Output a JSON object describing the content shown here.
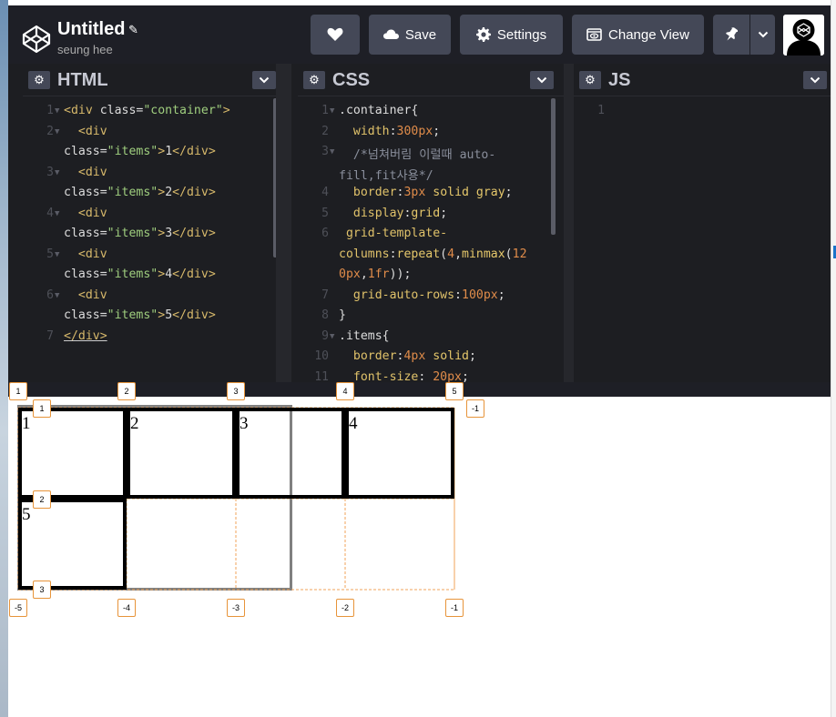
{
  "header": {
    "title": "Untitled",
    "author": "seung hee"
  },
  "toolbar": {
    "save_label": "Save",
    "settings_label": "Settings",
    "change_view_label": "Change View"
  },
  "panes": [
    {
      "title": "HTML"
    },
    {
      "title": "CSS"
    },
    {
      "title": "JS"
    }
  ],
  "html_code": {
    "line_numbers": [
      "1",
      "2",
      "3",
      "4",
      "5",
      "6",
      "7"
    ],
    "lines": [
      [
        {
          "t": "<div ",
          "c": "tg"
        },
        {
          "t": "class",
          "c": "at"
        },
        {
          "t": "=",
          "c": "at"
        },
        {
          "t": "\"container\"",
          "c": "st"
        },
        {
          "t": ">",
          "c": "tg"
        }
      ],
      [
        {
          "t": "  <div",
          "c": "tg"
        }
      ],
      [
        {
          "t": "class",
          "c": "at"
        },
        {
          "t": "=",
          "c": "at"
        },
        {
          "t": "\"items\"",
          "c": "st"
        },
        {
          "t": ">",
          "c": "tg"
        },
        {
          "t": "1",
          "c": "at"
        },
        {
          "t": "</div>",
          "c": "tg"
        }
      ],
      [
        {
          "t": "  <div",
          "c": "tg"
        }
      ],
      [
        {
          "t": "class",
          "c": "at"
        },
        {
          "t": "=",
          "c": "at"
        },
        {
          "t": "\"items\"",
          "c": "st"
        },
        {
          "t": ">",
          "c": "tg"
        },
        {
          "t": "2",
          "c": "at"
        },
        {
          "t": "</div>",
          "c": "tg"
        }
      ],
      [
        {
          "t": "  <div",
          "c": "tg"
        }
      ],
      [
        {
          "t": "class",
          "c": "at"
        },
        {
          "t": "=",
          "c": "at"
        },
        {
          "t": "\"items\"",
          "c": "st"
        },
        {
          "t": ">",
          "c": "tg"
        },
        {
          "t": "3",
          "c": "at"
        },
        {
          "t": "</div>",
          "c": "tg"
        }
      ],
      [
        {
          "t": "  <div",
          "c": "tg"
        }
      ],
      [
        {
          "t": "class",
          "c": "at"
        },
        {
          "t": "=",
          "c": "at"
        },
        {
          "t": "\"items\"",
          "c": "st"
        },
        {
          "t": ">",
          "c": "tg"
        },
        {
          "t": "4",
          "c": "at"
        },
        {
          "t": "</div>",
          "c": "tg"
        }
      ],
      [
        {
          "t": "  <div",
          "c": "tg"
        }
      ],
      [
        {
          "t": "class",
          "c": "at"
        },
        {
          "t": "=",
          "c": "at"
        },
        {
          "t": "\"items\"",
          "c": "st"
        },
        {
          "t": ">",
          "c": "tg"
        },
        {
          "t": "5",
          "c": "at"
        },
        {
          "t": "</div>",
          "c": "tg"
        }
      ],
      [
        {
          "t": "</div>",
          "c": "tg"
        }
      ]
    ]
  },
  "css_code": {
    "line_numbers": [
      "1",
      "2",
      "3",
      "4",
      "5",
      "6",
      "7",
      "8",
      "9",
      "10",
      "11"
    ],
    "lines": [
      [
        {
          "t": ".container",
          "c": "sel"
        },
        {
          "t": "{",
          "c": "at"
        }
      ],
      [
        {
          "t": "  width",
          "c": "pr"
        },
        {
          "t": ":",
          "c": "at"
        },
        {
          "t": "300px",
          "c": "nu"
        },
        {
          "t": ";",
          "c": "at"
        }
      ],
      [
        {
          "t": "  /*넘쳐버림 이럴때 auto-",
          "c": "cm"
        }
      ],
      [
        {
          "t": "fill,fit사용*/",
          "c": "cm"
        }
      ],
      [
        {
          "t": "  border",
          "c": "pr"
        },
        {
          "t": ":",
          "c": "at"
        },
        {
          "t": "3px",
          "c": "nu"
        },
        {
          "t": " solid gray",
          "c": "kw"
        },
        {
          "t": ";",
          "c": "at"
        }
      ],
      [
        {
          "t": "  display",
          "c": "pr"
        },
        {
          "t": ":",
          "c": "at"
        },
        {
          "t": "grid",
          "c": "kw"
        },
        {
          "t": ";",
          "c": "at"
        }
      ],
      [
        {
          "t": " grid-template-",
          "c": "pr"
        }
      ],
      [
        {
          "t": "columns",
          "c": "pr"
        },
        {
          "t": ":",
          "c": "at"
        },
        {
          "t": "repeat",
          "c": "kw"
        },
        {
          "t": "(",
          "c": "at"
        },
        {
          "t": "4",
          "c": "nu"
        },
        {
          "t": ",",
          "c": "at"
        },
        {
          "t": "minmax",
          "c": "kw"
        },
        {
          "t": "(",
          "c": "at"
        },
        {
          "t": "12",
          "c": "nu"
        }
      ],
      [
        {
          "t": "0px",
          "c": "nu"
        },
        {
          "t": ",",
          "c": "at"
        },
        {
          "t": "1fr",
          "c": "nu"
        },
        {
          "t": "));",
          "c": "at"
        }
      ],
      [
        {
          "t": "  grid-auto-rows",
          "c": "pr"
        },
        {
          "t": ":",
          "c": "at"
        },
        {
          "t": "100px",
          "c": "nu"
        },
        {
          "t": ";",
          "c": "at"
        }
      ],
      [
        {
          "t": "}",
          "c": "at"
        }
      ],
      [
        {
          "t": ".items",
          "c": "sel"
        },
        {
          "t": "{",
          "c": "at"
        }
      ],
      [
        {
          "t": "  border",
          "c": "pr"
        },
        {
          "t": ":",
          "c": "at"
        },
        {
          "t": "4px",
          "c": "nu"
        },
        {
          "t": " solid",
          "c": "kw"
        },
        {
          "t": ";",
          "c": "at"
        }
      ],
      [
        {
          "t": "  font-size",
          "c": "pr"
        },
        {
          "t": ": ",
          "c": "at"
        },
        {
          "t": "20px",
          "c": "nu"
        },
        {
          "t": ";",
          "c": "at"
        }
      ]
    ]
  },
  "js_code": {
    "line_numbers": [
      "1"
    ]
  },
  "preview": {
    "items": [
      "1",
      "2",
      "3",
      "4",
      "5"
    ],
    "col_badges_top": [
      "1",
      "2",
      "3",
      "4",
      "5"
    ],
    "col_badges_bottom": [
      "-5",
      "-4",
      "-3",
      "-2",
      "-1"
    ],
    "row_badges_left": [
      "1",
      "2",
      "3"
    ],
    "row_badge_right": "-1"
  }
}
